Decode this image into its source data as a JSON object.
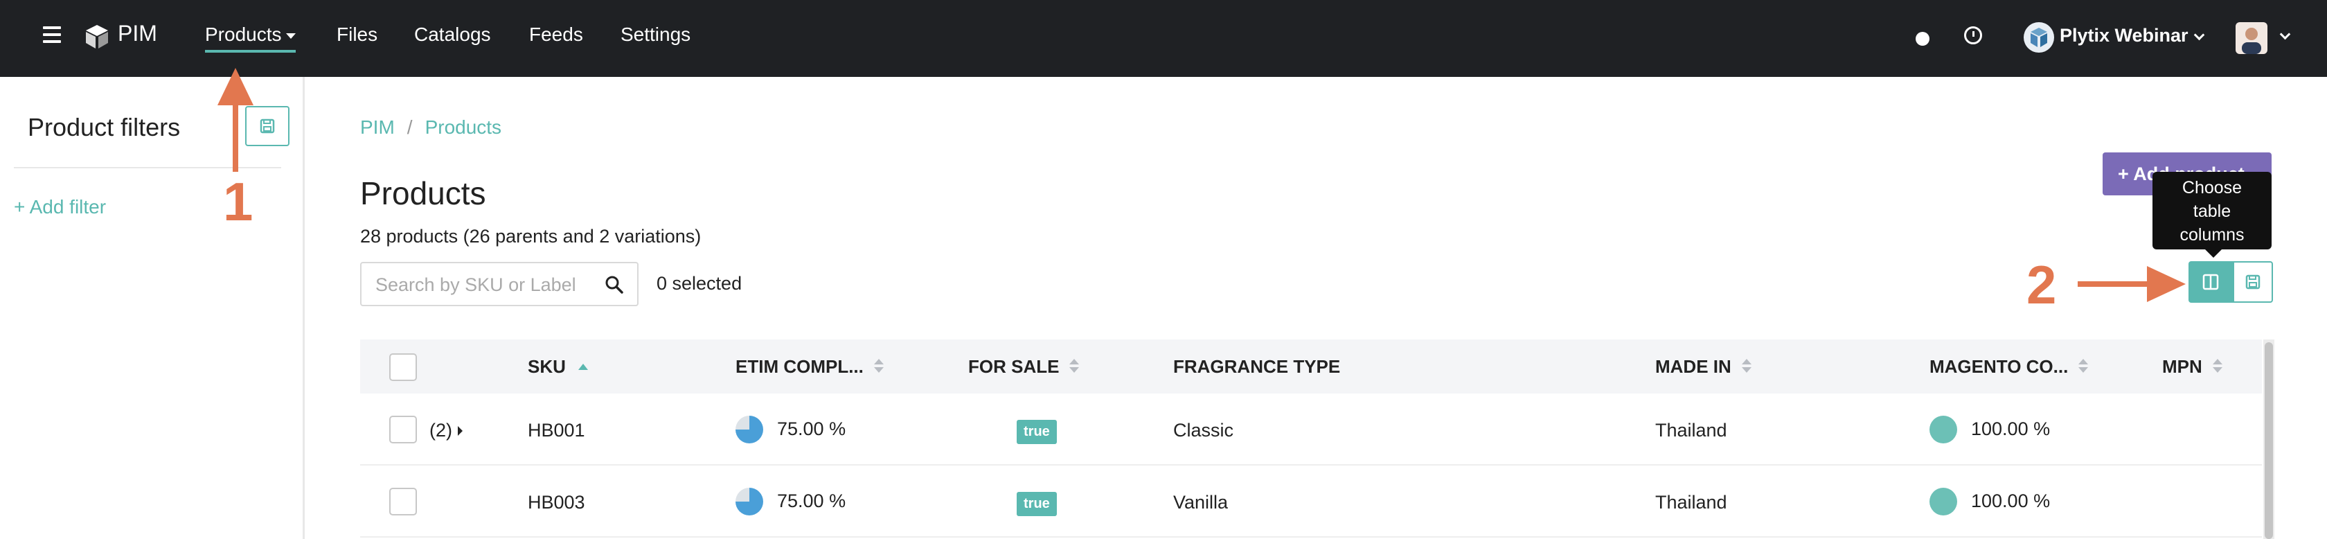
{
  "nav": {
    "brand": "PIM",
    "items": [
      {
        "label": "Products",
        "active": true
      },
      {
        "label": "Files"
      },
      {
        "label": "Catalogs"
      },
      {
        "label": "Feeds"
      },
      {
        "label": "Settings"
      }
    ],
    "org_name": "Plytix Webinar"
  },
  "sidebar": {
    "title": "Product filters",
    "add_filter": "+ Add filter"
  },
  "breadcrumb": [
    "PIM",
    "/",
    "Products"
  ],
  "page": {
    "title": "Products",
    "count_text": "28 products (26 parents and 2 variations)",
    "search_placeholder": "Search by SKU or Label",
    "selected_text": "0 selected",
    "add_button": "+ Add product",
    "tooltip_lines": [
      "Choose",
      "table",
      "columns"
    ]
  },
  "annotations": [
    "1",
    "2"
  ],
  "table": {
    "columns": [
      "SKU",
      "ETIM COMPL...",
      "FOR SALE",
      "FRAGRANCE TYPE",
      "MADE IN",
      "MAGENTO CO...",
      "MPN"
    ],
    "rows": [
      {
        "variants": "(2)",
        "sku": "HB001",
        "etim": "75.00 %",
        "for_sale": "true",
        "fragrance": "Classic",
        "made_in": "Thailand",
        "magento": "100.00 %",
        "mpn": ""
      },
      {
        "variants": "",
        "sku": "HB003",
        "etim": "75.00 %",
        "for_sale": "true",
        "fragrance": "Vanilla",
        "made_in": "Thailand",
        "magento": "100.00 %",
        "mpn": ""
      }
    ]
  },
  "colors": {
    "accent": "#5ab8b0",
    "nav_bg": "#1f2124",
    "primary_button": "#7b6bb7",
    "annotation": "#e2774f",
    "pie_fill": "#4a9fd8"
  },
  "icons": {
    "menu": "hamburger-icon",
    "logo": "cube-icon",
    "search": "search-icon",
    "save": "floppy-disk-icon",
    "columns": "columns-icon",
    "notifications": "dot-icon",
    "history": "clock-icon"
  }
}
